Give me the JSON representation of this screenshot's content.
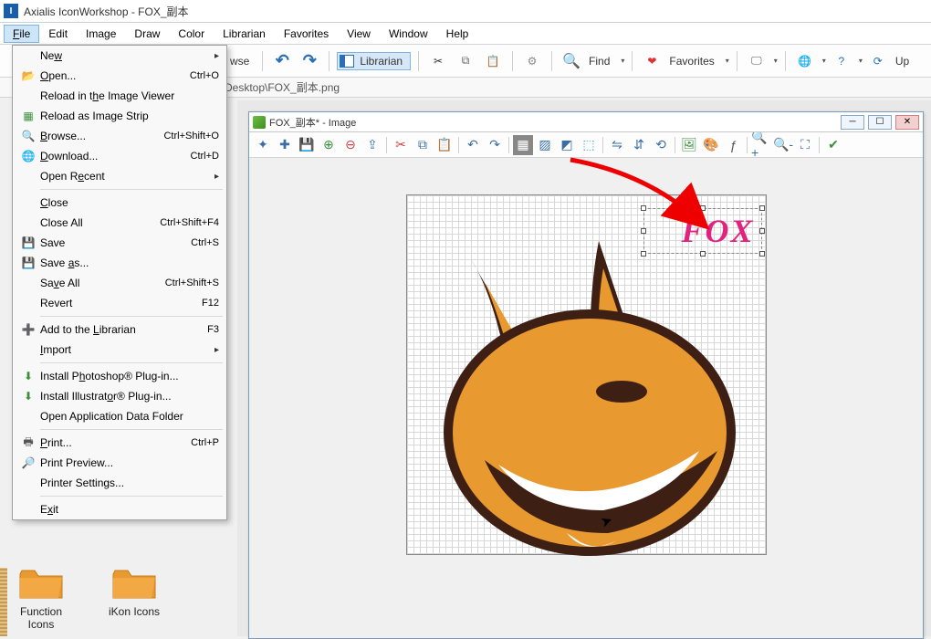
{
  "app": {
    "title": "Axialis IconWorkshop - FOX_副本",
    "icon_letter": "I"
  },
  "menubar": [
    "File",
    "Edit",
    "Image",
    "Draw",
    "Color",
    "Librarian",
    "Favorites",
    "View",
    "Window",
    "Help"
  ],
  "toolbar": {
    "browse_suffix": "wse",
    "librarian": "Librarian",
    "find": "Find",
    "favorites": "Favorites",
    "update_suffix": "Up"
  },
  "addressbar": {
    "path": "Desktop\\FOX_副本.png"
  },
  "file_menu": {
    "new": "New",
    "open": "Open...",
    "open_sc": "Ctrl+O",
    "reload_viewer": "Reload in the Image Viewer",
    "reload_strip": "Reload as Image Strip",
    "browse": "Browse...",
    "browse_sc": "Ctrl+Shift+O",
    "download": "Download...",
    "download_sc": "Ctrl+D",
    "open_recent": "Open Recent",
    "close": "Close",
    "close_all": "Close All",
    "close_all_sc": "Ctrl+Shift+F4",
    "save": "Save",
    "save_sc": "Ctrl+S",
    "save_as": "Save as...",
    "save_all": "Save All",
    "save_all_sc": "Ctrl+Shift+S",
    "revert": "Revert",
    "revert_sc": "F12",
    "add_librarian": "Add to the Librarian",
    "add_librarian_sc": "F3",
    "import": "Import",
    "install_ps": "Install Photoshop® Plug-in...",
    "install_ai": "Install Illustrator® Plug-in...",
    "open_appdata": "Open Application Data Folder",
    "print": "Print...",
    "print_sc": "Ctrl+P",
    "print_preview": "Print Preview...",
    "printer_settings": "Printer Settings...",
    "exit": "Exit"
  },
  "folders": {
    "function": "Function Icons",
    "ikon": "iKon Icons"
  },
  "doc": {
    "title": "FOX_副本* - Image",
    "text_overlay": "FOX"
  }
}
